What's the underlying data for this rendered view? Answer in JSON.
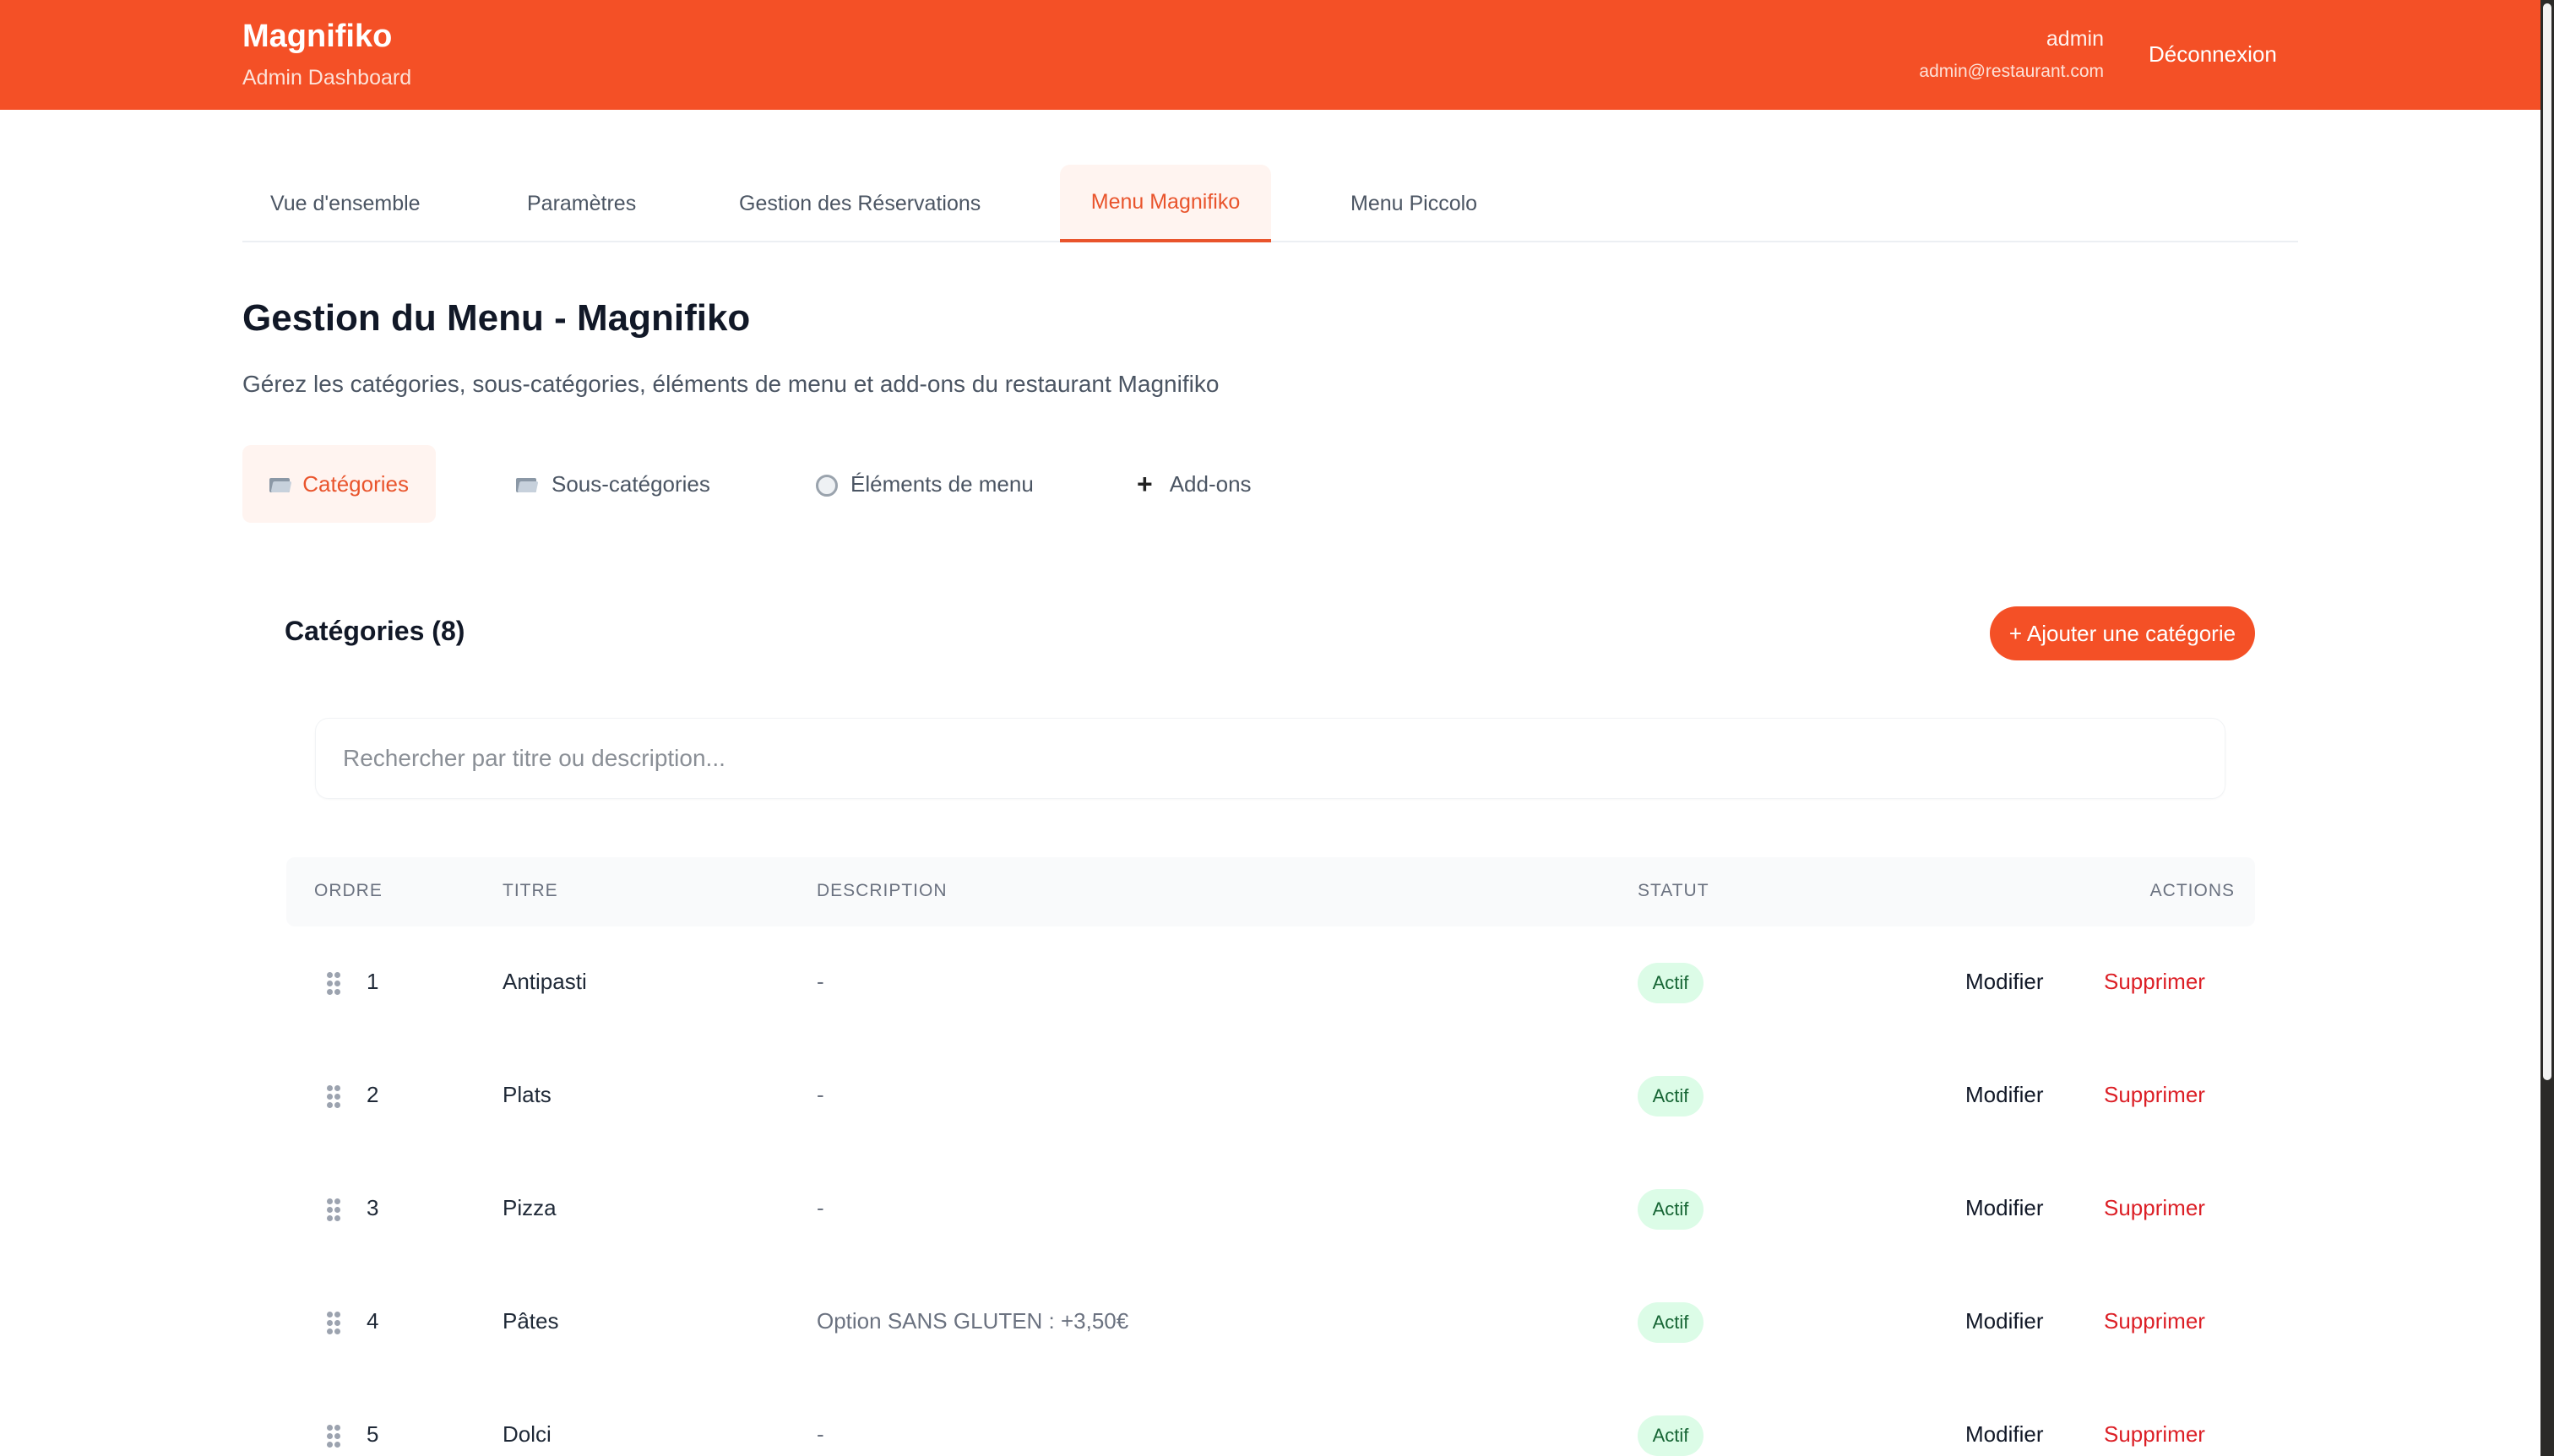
{
  "header": {
    "brand": "Magnifiko",
    "subtitle": "Admin Dashboard",
    "user_name": "admin",
    "user_email": "admin@restaurant.com",
    "logout": "Déconnexion"
  },
  "nav_tabs": [
    {
      "label": "Vue d'ensemble"
    },
    {
      "label": "Paramètres"
    },
    {
      "label": "Gestion des Réservations"
    },
    {
      "label": "Menu Magnifiko"
    },
    {
      "label": "Menu Piccolo"
    }
  ],
  "page": {
    "title": "Gestion du Menu - Magnifiko",
    "description": "Gérez les catégories, sous-catégories, éléments de menu et add-ons du restaurant Magnifiko"
  },
  "sub_tabs": [
    {
      "label": "Catégories",
      "icon": "folder-icon"
    },
    {
      "label": "Sous-catégories",
      "icon": "folder-icon"
    },
    {
      "label": "Éléments de menu",
      "icon": "plate-icon"
    },
    {
      "label": "Add-ons",
      "icon": "plus-icon"
    }
  ],
  "section": {
    "title": "Catégories (8)",
    "add_button": "+ Ajouter une catégorie",
    "search_placeholder": "Rechercher par titre ou description..."
  },
  "table": {
    "headers": [
      "ORDRE",
      "TITRE",
      "DESCRIPTION",
      "STATUT",
      "ACTIONS"
    ],
    "rows": [
      {
        "order": "1",
        "title": "Antipasti",
        "description": "-",
        "status": "Actif",
        "edit": "Modifier",
        "delete": "Supprimer"
      },
      {
        "order": "2",
        "title": "Plats",
        "description": "-",
        "status": "Actif",
        "edit": "Modifier",
        "delete": "Supprimer"
      },
      {
        "order": "3",
        "title": "Pizza",
        "description": "-",
        "status": "Actif",
        "edit": "Modifier",
        "delete": "Supprimer"
      },
      {
        "order": "4",
        "title": "Pâtes",
        "description": "Option SANS GLUTEN : +3,50€",
        "status": "Actif",
        "edit": "Modifier",
        "delete": "Supprimer"
      },
      {
        "order": "5",
        "title": "Dolci",
        "description": "-",
        "status": "Actif",
        "edit": "Modifier",
        "delete": "Supprimer"
      }
    ]
  },
  "colors": {
    "brand": "#f45026",
    "active_tab": "#e9542c",
    "status_bg": "#dcfce7",
    "status_text": "#166534",
    "delete": "#dc1f26"
  }
}
